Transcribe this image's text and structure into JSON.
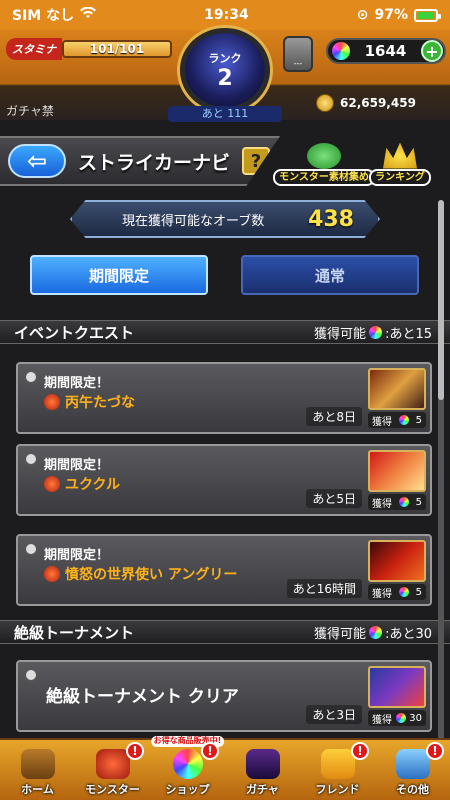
{
  "status_bar": {
    "carrier": "SIM なし",
    "time": "19:34",
    "battery": "97%"
  },
  "header": {
    "stamina_label": "スタミナ",
    "stamina_value": "101/101",
    "rank_label": "ランク",
    "rank_value": "2",
    "orb_stock_label": "---",
    "orb_count": "1644",
    "gacha_ban": "ガチャ禁",
    "next_rank": "あと 111",
    "gold": "62,659,459"
  },
  "title_bar": {
    "title": "ストライカーナビ",
    "help": "?",
    "material_label": "モンスター素材集め",
    "ranking_label": "ランキング"
  },
  "orb_banner": {
    "label": "現在獲得可能なオーブ数",
    "value": "438"
  },
  "tabs": [
    {
      "label": "期間限定",
      "active": true
    },
    {
      "label": "通常",
      "active": false
    }
  ],
  "sections": [
    {
      "title": "イベントクエスト",
      "obtainable": "獲得可能",
      "remaining": ":あと15"
    },
    {
      "title": "絶級トーナメント",
      "obtainable": "獲得可能",
      "remaining": ":あと30"
    }
  ],
  "quests": [
    {
      "tag": "期間限定！",
      "name": "丙午たづな",
      "time": "あと8日",
      "reward_label": "獲得",
      "reward": "5",
      "icons": [
        "red"
      ]
    },
    {
      "tag": "期間限定！",
      "name": "ユククル",
      "time": "あと5日",
      "reward_label": "獲得",
      "reward": "5",
      "icons": [
        "red",
        "gold"
      ]
    },
    {
      "tag": "期間限定！",
      "name": "憤怒の世界使い アングリー",
      "time": "あと16時間",
      "reward_label": "獲得",
      "reward": "5",
      "icons": [
        "red",
        "gold"
      ]
    }
  ],
  "tournament": {
    "title": "絶級トーナメント クリア",
    "time": "あと3日",
    "reward_label": "獲得",
    "reward": "30"
  },
  "bottom_nav": [
    {
      "label": "ホーム",
      "badge": ""
    },
    {
      "label": "モンスター",
      "badge": "!"
    },
    {
      "label": "ショップ",
      "badge": "!",
      "promo": "お得な商品販売中!"
    },
    {
      "label": "ガチャ",
      "badge": ""
    },
    {
      "label": "フレンド",
      "badge": "!"
    },
    {
      "label": "その他",
      "badge": "!"
    }
  ],
  "colors": {
    "accent_orange": "#e28a1c",
    "quest_name": "#ffb21a",
    "orb_value": "#ffe14a",
    "active_tab": "#1a6ae0"
  }
}
